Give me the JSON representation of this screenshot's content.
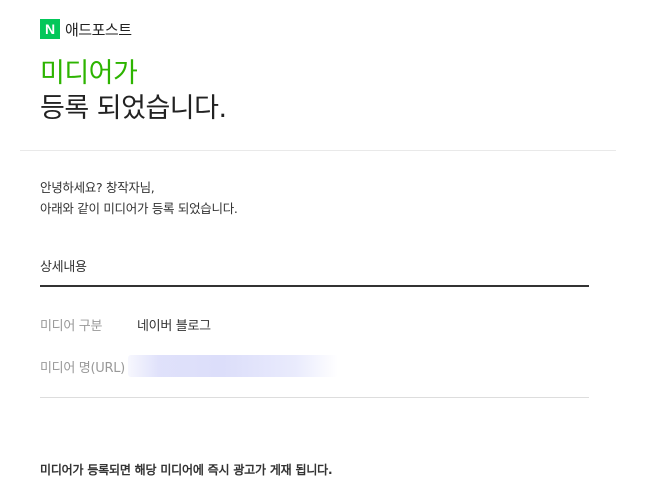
{
  "brand": {
    "logo_letter": "N",
    "name": "애드포스트",
    "logo_color": "#03c75a"
  },
  "headline": {
    "accent_line": "미디어가",
    "main_line": "등록 되었습니다.",
    "accent_color": "#2db400"
  },
  "intro": {
    "line1": "안녕하세요? 창작자님,",
    "line2": "아래와 같이 미디어가 등록 되었습니다."
  },
  "details": {
    "title": "상세내용",
    "rows": [
      {
        "label": "미디어 구분",
        "value": "네이버 블로그"
      },
      {
        "label": "미디어 명(URL)",
        "value": ""
      }
    ]
  },
  "notice": "미디어가 등록되면 해당 미디어에 즉시 광고가 게재 됩니다."
}
